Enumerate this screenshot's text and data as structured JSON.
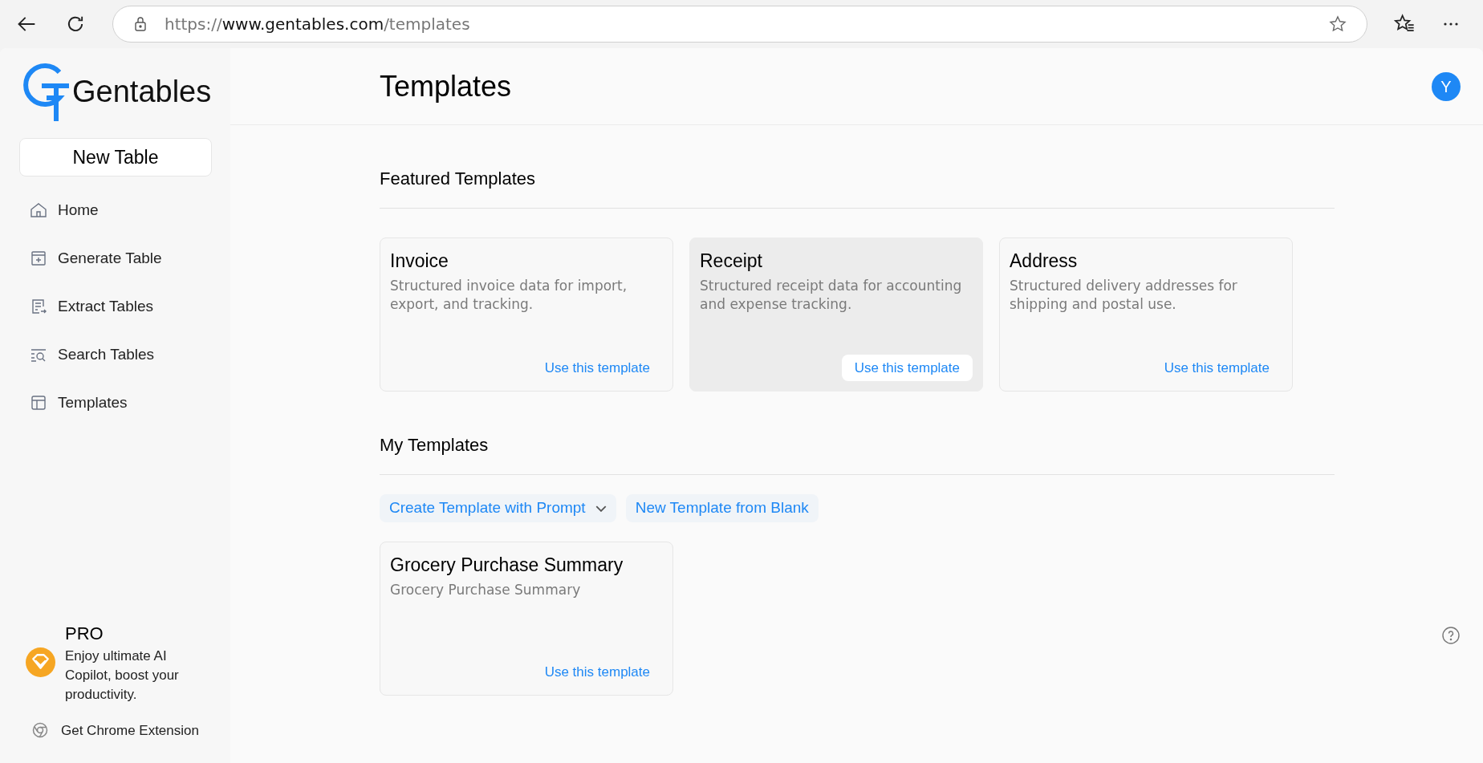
{
  "browser": {
    "url": {
      "scheme": "https://",
      "host": "www.gentables.com",
      "path": "/templates"
    }
  },
  "sidebar": {
    "brand": "Gentables",
    "new_button": "New Table",
    "items": [
      {
        "label": "Home",
        "selected": false
      },
      {
        "label": "Generate Table",
        "selected": false
      },
      {
        "label": "Extract Tables",
        "selected": false
      },
      {
        "label": "Search Tables",
        "selected": false
      },
      {
        "label": "Templates",
        "selected": false
      }
    ],
    "pro": {
      "title": "PRO",
      "text": "Enjoy ultimate AI Copilot, boost your productivity."
    },
    "extension": "Get Chrome Extension"
  },
  "header": {
    "title": "Templates",
    "avatar": "Y"
  },
  "featured": {
    "title": "Featured Templates",
    "cards": [
      {
        "title": "Invoice",
        "description": "Structured invoice data for import, export, and tracking.",
        "action": "Use this template",
        "highlighted": false
      },
      {
        "title": "Receipt",
        "description": "Structured receipt data for accounting and expense tracking.",
        "action": "Use this template",
        "highlighted": true
      },
      {
        "title": "Address",
        "description": "Structured delivery addresses for shipping and postal use.",
        "action": "Use this template",
        "highlighted": false
      }
    ]
  },
  "my_templates": {
    "title": "My Templates",
    "actions": [
      {
        "label": "Create Template with Prompt",
        "dropdown": true
      },
      {
        "label": "New Template from Blank",
        "dropdown": false
      }
    ],
    "cards": [
      {
        "title": "Grocery Purchase Summary",
        "description": "Grocery Purchase Summary",
        "action": "Use this template",
        "highlighted": false
      }
    ]
  }
}
